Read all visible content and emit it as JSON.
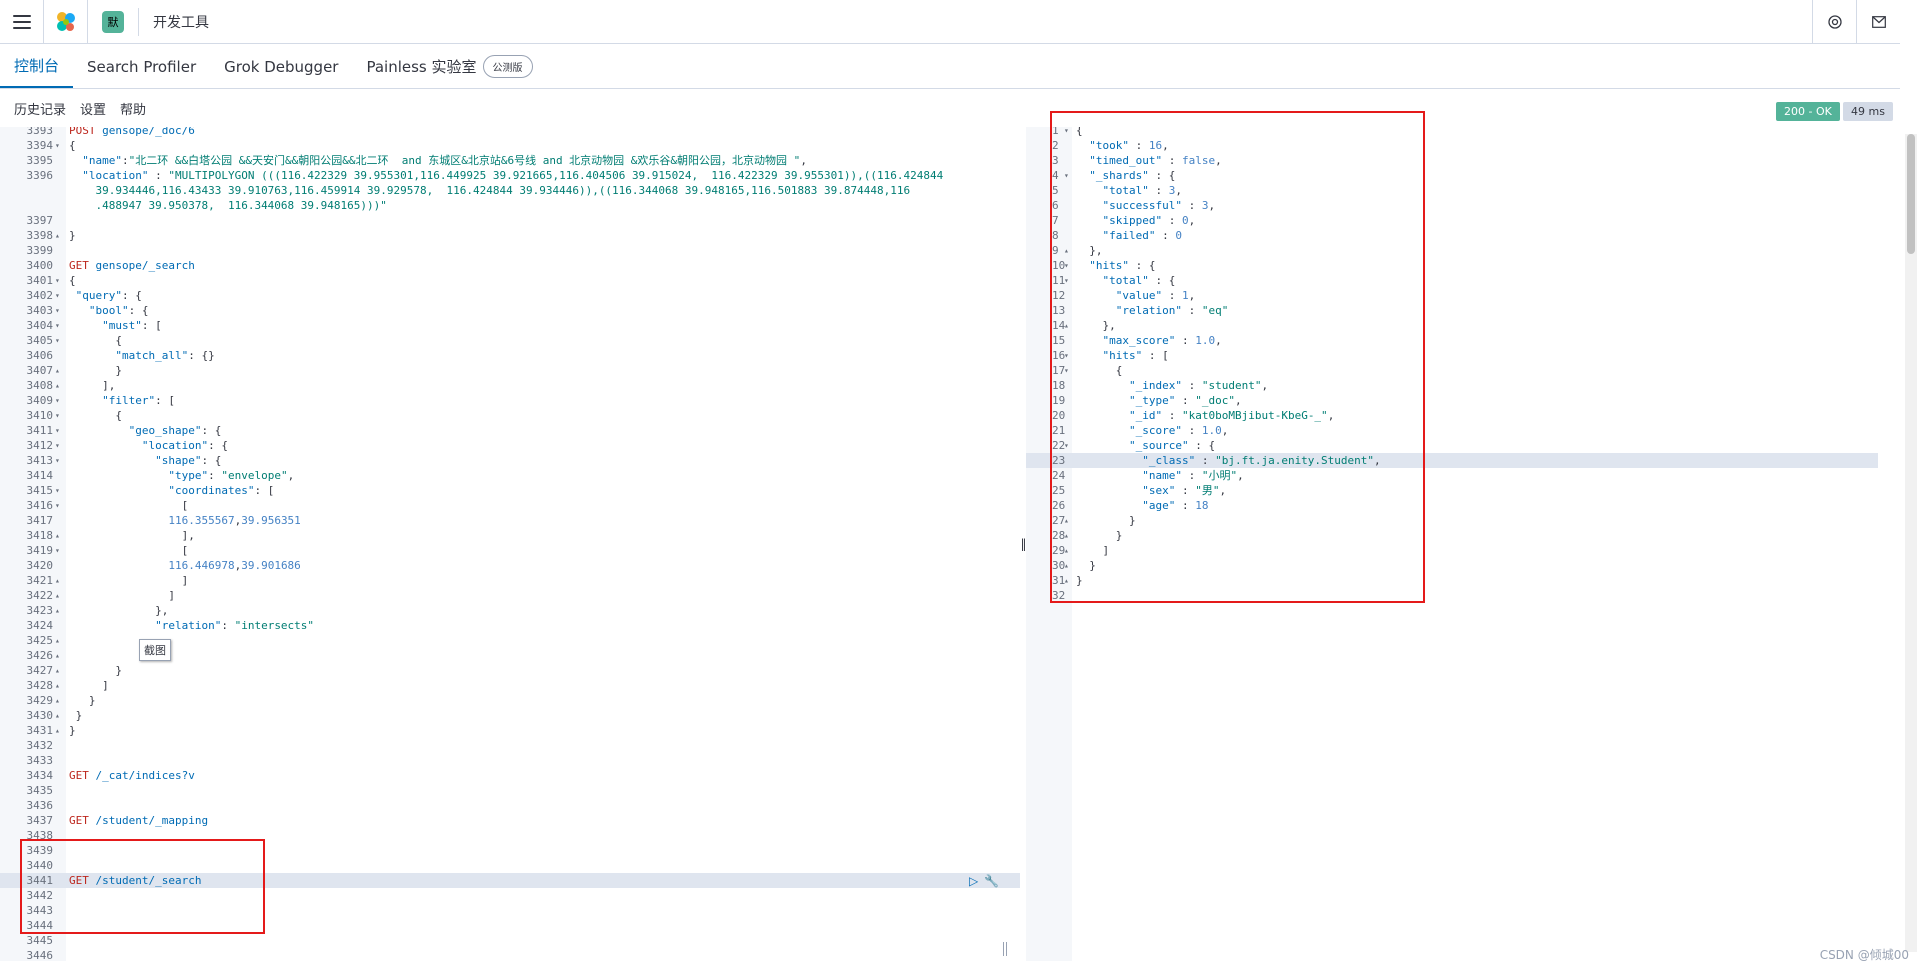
{
  "header": {
    "space_initial": "默",
    "breadcrumb": "开发工具",
    "icons": [
      "menu-icon",
      "elastic-logo-icon",
      "help-icon",
      "mail-icon"
    ]
  },
  "tabs": [
    {
      "label": "控制台",
      "active": true
    },
    {
      "label": "Search Profiler",
      "active": false
    },
    {
      "label": "Grok Debugger",
      "active": false
    },
    {
      "label": "Painless 实验室",
      "active": false,
      "badge": "公测版"
    }
  ],
  "toolbar": {
    "history": "历史记录",
    "settings": "设置",
    "help": "帮助",
    "status": "200 - OK",
    "time": "49 ms"
  },
  "request_editor": {
    "current_line": "3441",
    "lines": [
      {
        "n": "3393",
        "fold": "",
        "html": "<span class=\"k\">POST</span> <span class=\"s\">gensope/_doc/6</span>"
      },
      {
        "n": "3394",
        "fold": "▾",
        "html": "{"
      },
      {
        "n": "3395",
        "fold": "",
        "html": "  <span class=\"s\">\"name\"</span>:<span class=\"n\">\"北二环 &&白塔公园 &&天安门&&朝阳公园&&北二环  and 东城区&北京站&6号线 and 北京动物园 &欢乐谷&朝阳公园，北京动物园 \"</span>,"
      },
      {
        "n": "3396",
        "fold": "",
        "html": "  <span class=\"s\">\"location\"</span> : <span class=\"n\">\"MULTIPOLYGON (((116.422329 39.955301,116.449925 39.921665,116.404506 39.915024,  116.422329 39.955301)),((116.424844</span>"
      },
      {
        "n": "",
        "fold": "",
        "html": "    <span class=\"n\">39.934446,116.43433 39.910763,116.459914 39.929578,  116.424844 39.934446)),((116.344068 39.948165,116.501883 39.874448,116</span>"
      },
      {
        "n": "",
        "fold": "",
        "html": "    <span class=\"n\">.488947 39.950378,  116.344068 39.948165)))\"</span>"
      },
      {
        "n": "3397",
        "fold": "",
        "html": ""
      },
      {
        "n": "3398",
        "fold": "▴",
        "html": "}"
      },
      {
        "n": "3399",
        "fold": "",
        "html": ""
      },
      {
        "n": "3400",
        "fold": "",
        "html": "<span class=\"k\">GET</span> <span class=\"s\">gensope/_search</span>"
      },
      {
        "n": "3401",
        "fold": "▾",
        "html": "{"
      },
      {
        "n": "3402",
        "fold": "▾",
        "html": " <span class=\"s\">\"query\"</span>: {"
      },
      {
        "n": "3403",
        "fold": "▾",
        "html": "   <span class=\"s\">\"bool\"</span>: {"
      },
      {
        "n": "3404",
        "fold": "▾",
        "html": "     <span class=\"s\">\"must\"</span>: ["
      },
      {
        "n": "3405",
        "fold": "▾",
        "html": "       {"
      },
      {
        "n": "3406",
        "fold": "",
        "html": "       <span class=\"s\">\"match_all\"</span>: {}"
      },
      {
        "n": "3407",
        "fold": "▴",
        "html": "       }"
      },
      {
        "n": "3408",
        "fold": "▴",
        "html": "     ],"
      },
      {
        "n": "3409",
        "fold": "▾",
        "html": "     <span class=\"s\">\"filter\"</span>: ["
      },
      {
        "n": "3410",
        "fold": "▾",
        "html": "       {"
      },
      {
        "n": "3411",
        "fold": "▾",
        "html": "         <span class=\"s\">\"geo_shape\"</span>: {"
      },
      {
        "n": "3412",
        "fold": "▾",
        "html": "           <span class=\"s\">\"location\"</span>: {"
      },
      {
        "n": "3413",
        "fold": "▾",
        "html": "             <span class=\"s\">\"shape\"</span>: {"
      },
      {
        "n": "3414",
        "fold": "",
        "html": "               <span class=\"s\">\"type\"</span>: <span class=\"n\">\"envelope\"</span>,"
      },
      {
        "n": "3415",
        "fold": "▾",
        "html": "               <span class=\"s\">\"coordinates\"</span>: ["
      },
      {
        "n": "3416",
        "fold": "▾",
        "html": "                 ["
      },
      {
        "n": "3417",
        "fold": "",
        "html": "               <span class=\"kw\">116.355567</span>,<span class=\"kw\">39.956351</span>"
      },
      {
        "n": "3418",
        "fold": "▴",
        "html": "                 ],"
      },
      {
        "n": "3419",
        "fold": "▾",
        "html": "                 ["
      },
      {
        "n": "3420",
        "fold": "",
        "html": "               <span class=\"kw\">116.446978</span>,<span class=\"kw\">39.901686</span>"
      },
      {
        "n": "3421",
        "fold": "▴",
        "html": "                 ]"
      },
      {
        "n": "3422",
        "fold": "▴",
        "html": "               ]"
      },
      {
        "n": "3423",
        "fold": "▴",
        "html": "             },"
      },
      {
        "n": "3424",
        "fold": "",
        "html": "             <span class=\"s\">\"relation\"</span>: <span class=\"n\">\"intersects\"</span>"
      },
      {
        "n": "3425",
        "fold": "▴",
        "html": ""
      },
      {
        "n": "3426",
        "fold": "▴",
        "html": ""
      },
      {
        "n": "3427",
        "fold": "▴",
        "html": "       }"
      },
      {
        "n": "3428",
        "fold": "▴",
        "html": "     ]"
      },
      {
        "n": "3429",
        "fold": "▴",
        "html": "   }"
      },
      {
        "n": "3430",
        "fold": "▴",
        "html": " }"
      },
      {
        "n": "3431",
        "fold": "▴",
        "html": "}"
      },
      {
        "n": "3432",
        "fold": "",
        "html": ""
      },
      {
        "n": "3433",
        "fold": "",
        "html": ""
      },
      {
        "n": "3434",
        "fold": "",
        "html": "<span class=\"k\">GET</span> <span class=\"s\">/_cat/indices?v</span>"
      },
      {
        "n": "3435",
        "fold": "",
        "html": ""
      },
      {
        "n": "3436",
        "fold": "",
        "html": ""
      },
      {
        "n": "3437",
        "fold": "",
        "html": "<span class=\"k\">GET</span> <span class=\"s\">/student/_mapping</span>"
      },
      {
        "n": "3438",
        "fold": "",
        "html": ""
      },
      {
        "n": "3439",
        "fold": "",
        "html": ""
      },
      {
        "n": "3440",
        "fold": "",
        "html": ""
      },
      {
        "n": "3441",
        "fold": "",
        "html": "<span class=\"k\">GET</span> <span class=\"s\">/student/_search</span>"
      },
      {
        "n": "3442",
        "fold": "",
        "html": ""
      },
      {
        "n": "3443",
        "fold": "",
        "html": ""
      },
      {
        "n": "3444",
        "fold": "",
        "html": ""
      },
      {
        "n": "3445",
        "fold": "",
        "html": ""
      },
      {
        "n": "3446",
        "fold": "",
        "html": ""
      }
    ]
  },
  "tooltip": "截图",
  "response_editor": {
    "current_line": "23",
    "lines": [
      {
        "n": "1",
        "fold": "▾",
        "html": "{"
      },
      {
        "n": "2",
        "fold": "",
        "html": "  <span class=\"s\">\"took\"</span> : <span class=\"kw\">16</span>,"
      },
      {
        "n": "3",
        "fold": "",
        "html": "  <span class=\"s\">\"timed_out\"</span> : <span class=\"kw\">false</span>,"
      },
      {
        "n": "4",
        "fold": "▾",
        "html": "  <span class=\"s\">\"_shards\"</span> : {"
      },
      {
        "n": "5",
        "fold": "",
        "html": "    <span class=\"s\">\"total\"</span> : <span class=\"kw\">3</span>,"
      },
      {
        "n": "6",
        "fold": "",
        "html": "    <span class=\"s\">\"successful\"</span> : <span class=\"kw\">3</span>,"
      },
      {
        "n": "7",
        "fold": "",
        "html": "    <span class=\"s\">\"skipped\"</span> : <span class=\"kw\">0</span>,"
      },
      {
        "n": "8",
        "fold": "",
        "html": "    <span class=\"s\">\"failed\"</span> : <span class=\"kw\">0</span>"
      },
      {
        "n": "9",
        "fold": "▴",
        "html": "  },"
      },
      {
        "n": "10",
        "fold": "▾",
        "html": "  <span class=\"s\">\"hits\"</span> : {"
      },
      {
        "n": "11",
        "fold": "▾",
        "html": "    <span class=\"s\">\"total\"</span> : {"
      },
      {
        "n": "12",
        "fold": "",
        "html": "      <span class=\"s\">\"value\"</span> : <span class=\"kw\">1</span>,"
      },
      {
        "n": "13",
        "fold": "",
        "html": "      <span class=\"s\">\"relation\"</span> : <span class=\"n\">\"eq\"</span>"
      },
      {
        "n": "14",
        "fold": "▴",
        "html": "    },"
      },
      {
        "n": "15",
        "fold": "",
        "html": "    <span class=\"s\">\"max_score\"</span> : <span class=\"kw\">1.0</span>,"
      },
      {
        "n": "16",
        "fold": "▾",
        "html": "    <span class=\"s\">\"hits\"</span> : ["
      },
      {
        "n": "17",
        "fold": "▾",
        "html": "      {"
      },
      {
        "n": "18",
        "fold": "",
        "html": "        <span class=\"s\">\"_index\"</span> : <span class=\"n\">\"student\"</span>,"
      },
      {
        "n": "19",
        "fold": "",
        "html": "        <span class=\"s\">\"_type\"</span> : <span class=\"n\">\"_doc\"</span>,"
      },
      {
        "n": "20",
        "fold": "",
        "html": "        <span class=\"s\">\"_id\"</span> : <span class=\"n\">\"kat0boMBjibut-KbeG-_\"</span>,"
      },
      {
        "n": "21",
        "fold": "",
        "html": "        <span class=\"s\">\"_score\"</span> : <span class=\"kw\">1.0</span>,"
      },
      {
        "n": "22",
        "fold": "▾",
        "html": "        <span class=\"s\">\"_source\"</span> : {"
      },
      {
        "n": "23",
        "fold": "",
        "html": "          <span class=\"s\">\"_class\"</span> : <span class=\"n\">\"bj.ft.ja.enity.Student\"</span>,"
      },
      {
        "n": "24",
        "fold": "",
        "html": "          <span class=\"s\">\"name\"</span> : <span class=\"n\">\"小明\"</span>,"
      },
      {
        "n": "25",
        "fold": "",
        "html": "          <span class=\"s\">\"sex\"</span> : <span class=\"n\">\"男\"</span>,"
      },
      {
        "n": "26",
        "fold": "",
        "html": "          <span class=\"s\">\"age\"</span> : <span class=\"kw\">18</span>"
      },
      {
        "n": "27",
        "fold": "▴",
        "html": "        }"
      },
      {
        "n": "28",
        "fold": "▴",
        "html": "      }"
      },
      {
        "n": "29",
        "fold": "▴",
        "html": "    ]"
      },
      {
        "n": "30",
        "fold": "▴",
        "html": "  }"
      },
      {
        "n": "31",
        "fold": "▴",
        "html": "}"
      },
      {
        "n": "32",
        "fold": "",
        "html": ""
      }
    ]
  },
  "watermark": "CSDN @倾城00"
}
